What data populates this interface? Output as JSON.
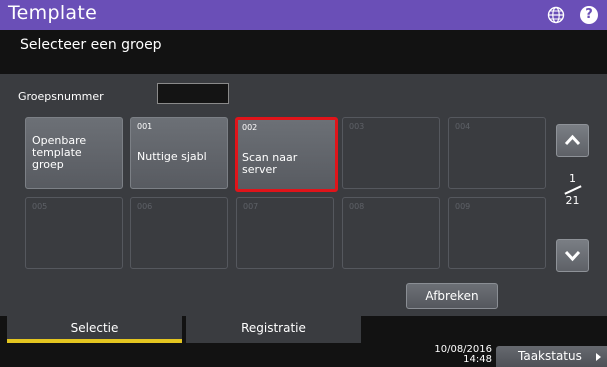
{
  "header": {
    "title": "Template",
    "subtitle": "Selecteer een groep"
  },
  "group_field": {
    "label": "Groepsnummer",
    "value": ""
  },
  "tiles": [
    {
      "label_lines": [
        "Openbare",
        "template",
        "groep"
      ]
    },
    {
      "number": "001",
      "label": "Nuttige sjabl"
    },
    {
      "number": "002",
      "label": "Scan naar server",
      "selected": true
    },
    {
      "number": "003"
    },
    {
      "number": "004"
    },
    {
      "number": "005"
    },
    {
      "number": "006"
    },
    {
      "number": "007"
    },
    {
      "number": "008"
    },
    {
      "number": "009"
    }
  ],
  "pager": {
    "current": "1",
    "total": "21"
  },
  "cancel_label": "Afbreken",
  "tabs": [
    {
      "label": "Selectie",
      "active": true
    },
    {
      "label": "Registratie",
      "active": false
    }
  ],
  "status": {
    "date": "10/08/2016",
    "time": "14:48",
    "job_status_label": "Taakstatus"
  },
  "colors": {
    "title_bar": "#6a4fb7",
    "selected_border": "#e0141a",
    "active_tab_underline": "#e3c520"
  }
}
